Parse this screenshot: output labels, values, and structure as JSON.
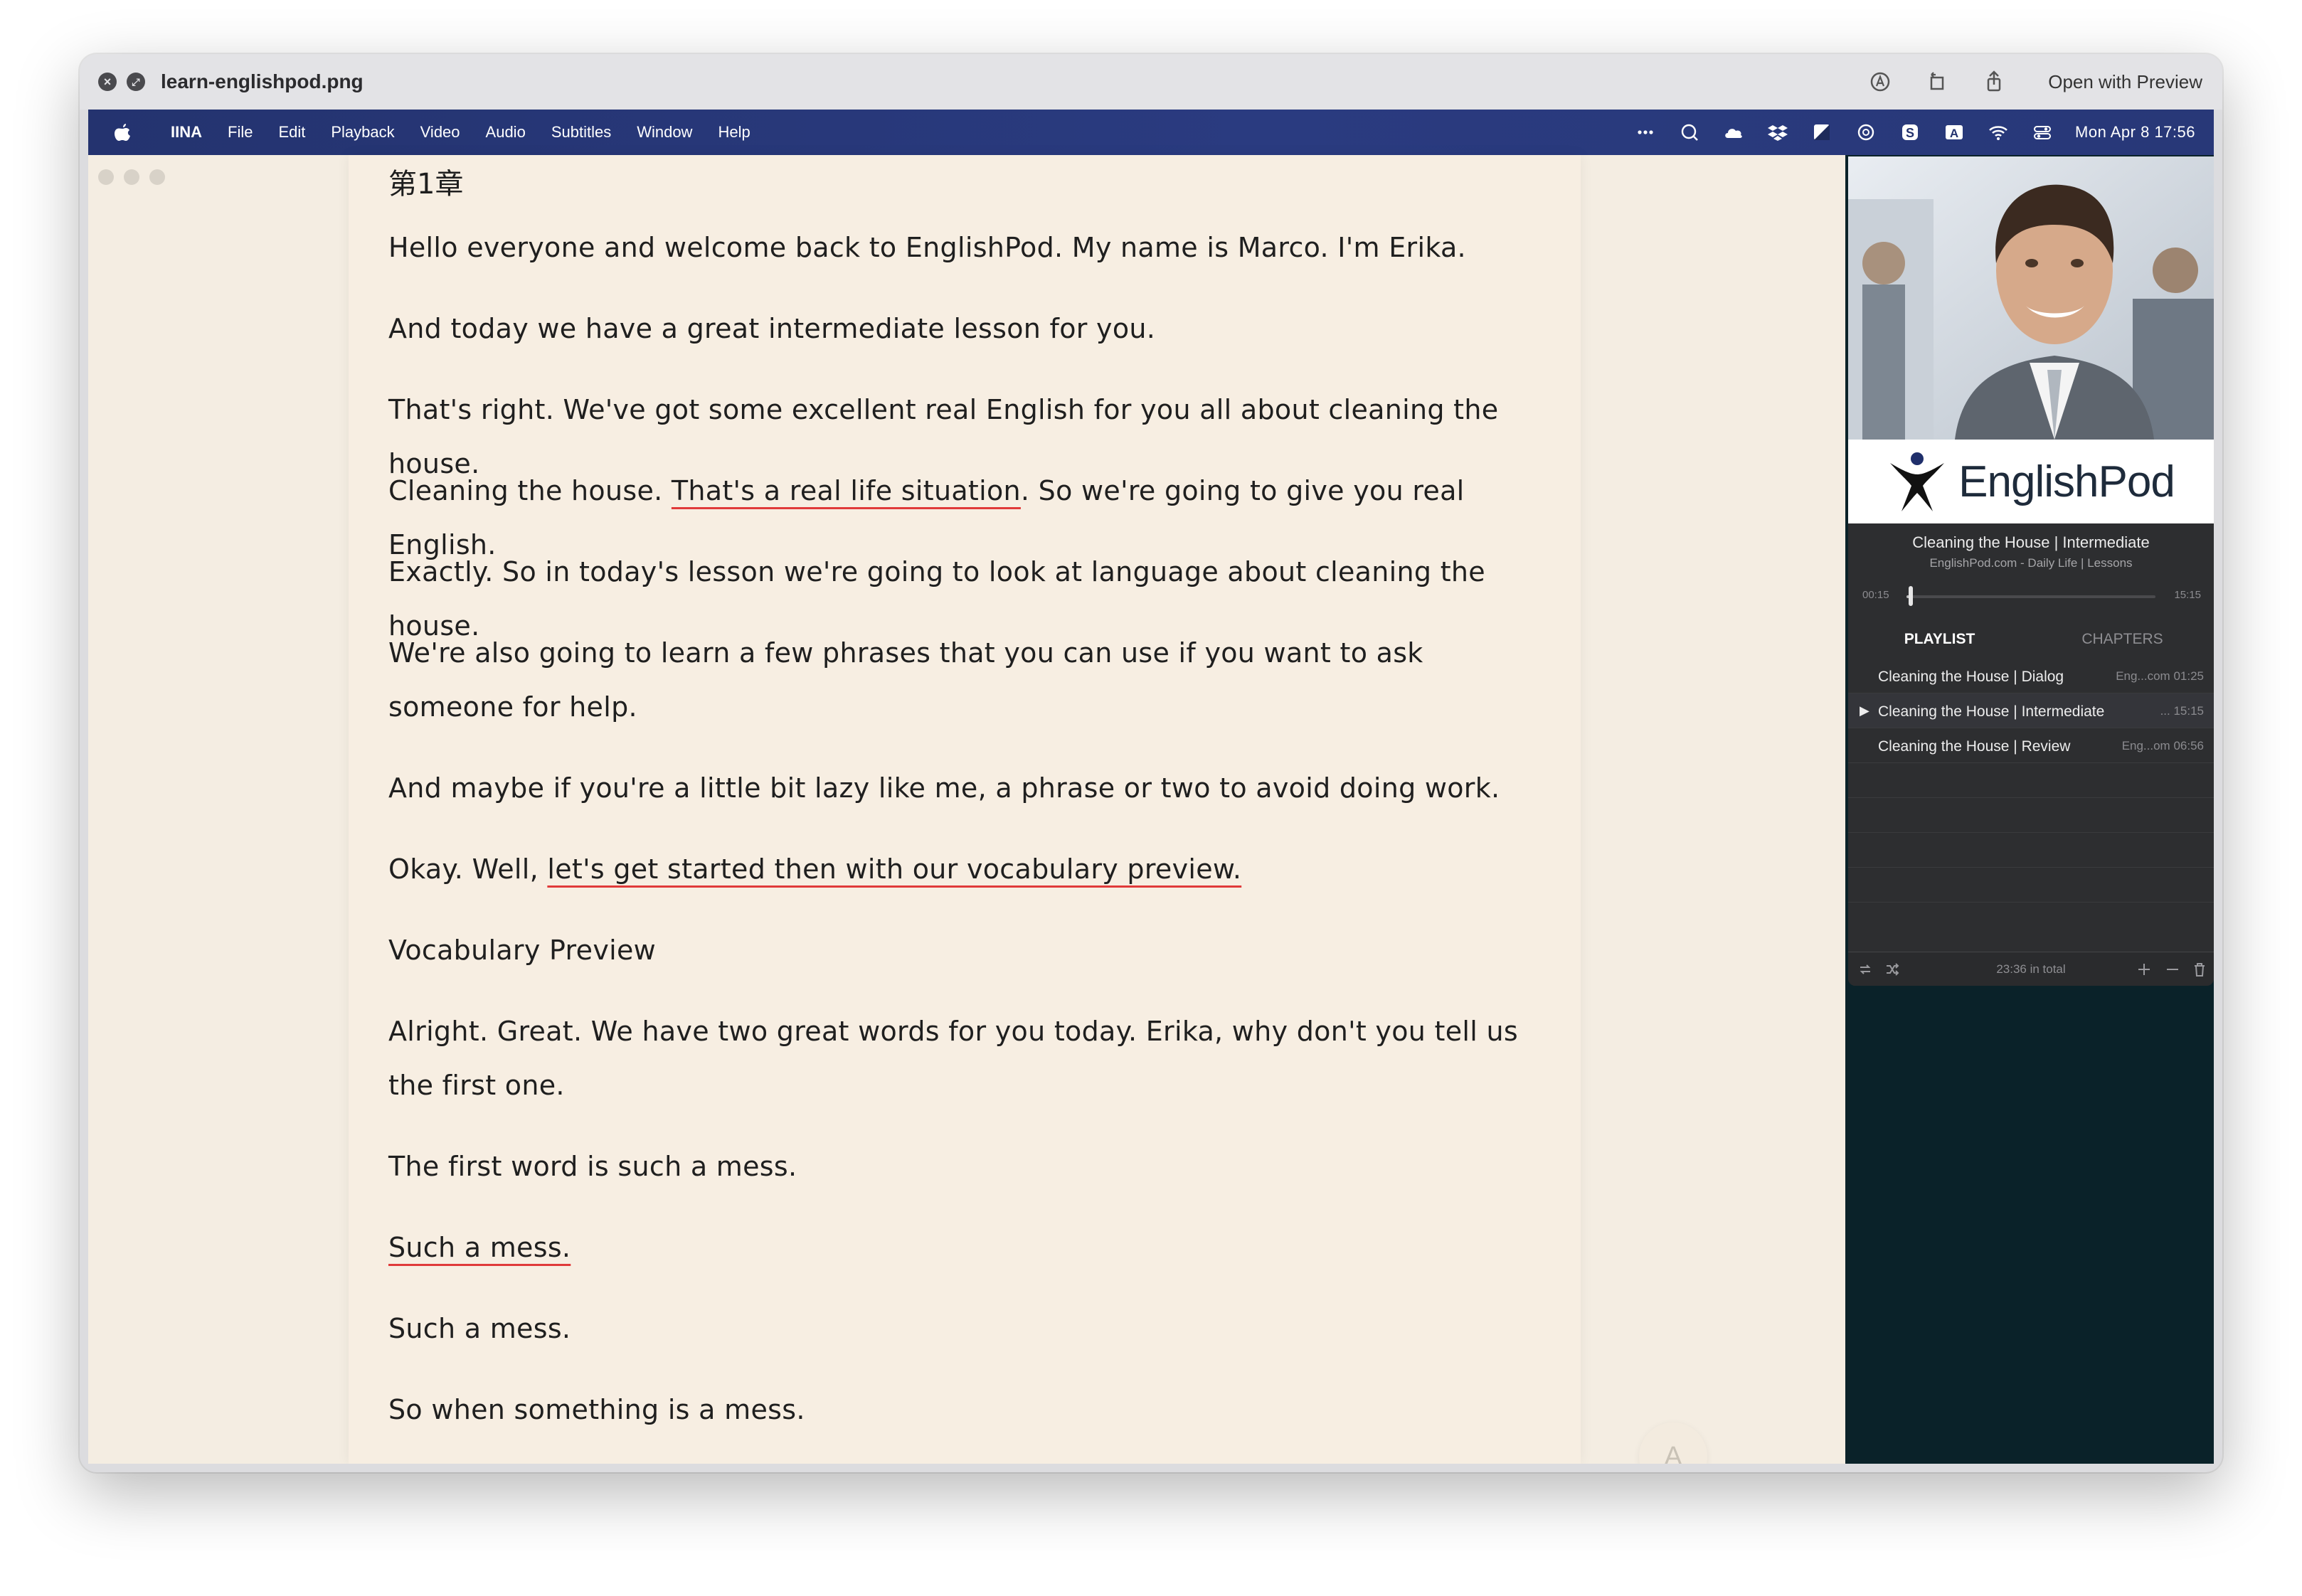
{
  "quicklook": {
    "filename": "learn-englishpod.png",
    "open_button": "Open with Preview"
  },
  "menubar": {
    "app_name": "IINA",
    "items": [
      "File",
      "Edit",
      "Playback",
      "Video",
      "Audio",
      "Subtitles",
      "Window",
      "Help"
    ],
    "clock": "Mon Apr 8  17:56"
  },
  "reader": {
    "chapter": "第1章",
    "paragraphs": [
      {
        "pre": "Hello everyone and welcome back to EnglishPod. My name is Marco. I'm Erika.",
        "hl": "",
        "post": ""
      },
      {
        "pre": "And today we have a great intermediate lesson for you.",
        "hl": "",
        "post": ""
      },
      {
        "pre": "That's right. We've got some excellent real English for you all about cleaning the house.",
        "hl": "",
        "post": ""
      },
      {
        "pre": "Cleaning the house. ",
        "hl": "That's a real life situation",
        "post": ". So we're going to give you real English."
      },
      {
        "pre": "Exactly. So in today's lesson we're going to look at language about cleaning the house.",
        "hl": "",
        "post": ""
      },
      {
        "pre": "We're also going to learn a few phrases that you can use if you want to ask someone for help.",
        "hl": "",
        "post": ""
      },
      {
        "pre": "And maybe if you're a little bit lazy like me, a phrase or two to avoid doing work.",
        "hl": "",
        "post": ""
      },
      {
        "pre": "Okay. Well, ",
        "hl": "let's get started then with our vocabulary preview.",
        "post": ""
      },
      {
        "pre": "Vocabulary Preview",
        "hl": "",
        "post": ""
      },
      {
        "pre": "Alright. Great. We have two great words for you today. Erika, why don't you tell us the first one.",
        "hl": "",
        "post": ""
      },
      {
        "pre": "The first word is such a mess.",
        "hl": "",
        "post": ""
      },
      {
        "pre": "",
        "hl": "Such a mess.",
        "post": ""
      },
      {
        "pre": "Such a mess.",
        "hl": "",
        "post": ""
      },
      {
        "pre": "So when something is a mess.",
        "hl": "",
        "post": ""
      }
    ],
    "font_button": "A"
  },
  "player": {
    "logo_text": "EnglishPod",
    "track_title": "Cleaning the House | Intermediate",
    "track_subtitle": "EnglishPod.com - Daily Life | Lessons",
    "time_elapsed": "00:15",
    "time_total": "15:15",
    "progress_fraction": 0.016,
    "tabs": [
      "PLAYLIST",
      "CHAPTERS"
    ],
    "playlist": [
      {
        "title": "Cleaning the House | Dialog",
        "meta": "Eng...com 01:25",
        "current": false
      },
      {
        "title": "Cleaning the House | Intermediate",
        "meta": "... 15:15",
        "current": true
      },
      {
        "title": "Cleaning the House | Review",
        "meta": "Eng...om 06:56",
        "current": false
      }
    ],
    "total_label": "23:36 in total"
  }
}
